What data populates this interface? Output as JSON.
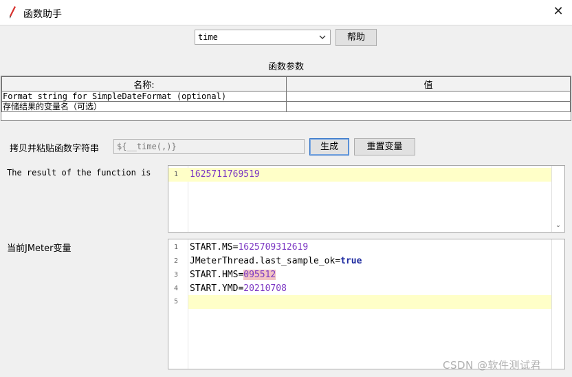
{
  "window": {
    "title": "函数助手",
    "close_glyph": "✕"
  },
  "function_select": {
    "value": "time"
  },
  "help_button": "帮助",
  "params_section": {
    "title": "函数参数",
    "headers": [
      "名称:",
      "值"
    ],
    "rows": [
      {
        "name": "Format string for SimpleDateFormat (optional)",
        "value": ""
      },
      {
        "name": "存储结果的变量名（可选）",
        "value": ""
      }
    ]
  },
  "copy_row": {
    "label": "拷贝并粘贴函数字符串",
    "value": "${__time(,)}",
    "generate_button": "生成",
    "reset_button": "重置变量"
  },
  "result": {
    "label": "The result of the function is",
    "lines": [
      {
        "n": "1",
        "value": "1625711769519"
      }
    ]
  },
  "variables": {
    "label": "当前JMeter变量",
    "lines": [
      {
        "n": "1",
        "key": "START.MS=",
        "value": "1625709312619"
      },
      {
        "n": "2",
        "key": "JMeterThread.last_sample_ok=",
        "value": "true"
      },
      {
        "n": "3",
        "key": "START.HMS=",
        "value": "095512"
      },
      {
        "n": "4",
        "key": "START.YMD=",
        "value": "20210708"
      },
      {
        "n": "5",
        "key": "",
        "value": ""
      }
    ]
  },
  "watermark": "CSDN @软件测试君",
  "icons": {
    "app": "feather-pen-icon",
    "close": "close-icon",
    "dropdown": "chevron-down-icon"
  }
}
